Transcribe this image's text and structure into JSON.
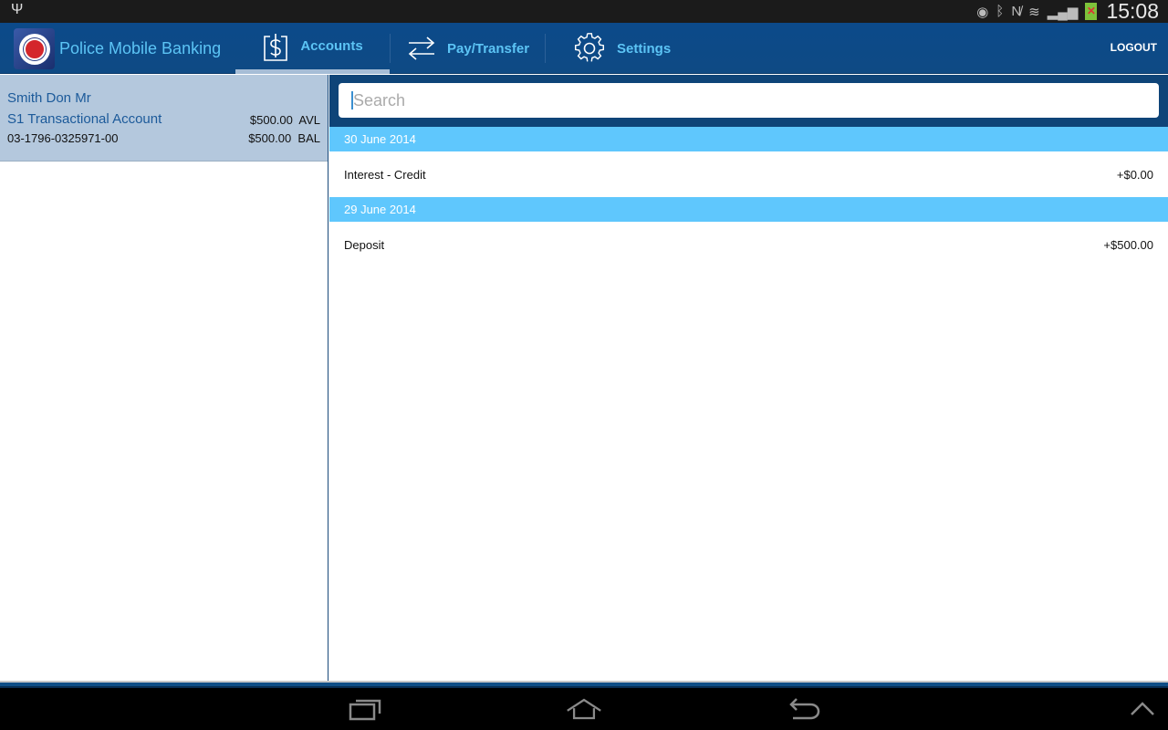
{
  "status_bar": {
    "usb_icon": "usb-icon",
    "icons": [
      "eye-icon",
      "bluetooth-icon",
      "nfc-muted-icon",
      "wifi-icon",
      "signal-icon",
      "battery-icon"
    ],
    "time": "15:08"
  },
  "action_bar": {
    "app_title": "Police Mobile Banking",
    "tabs": [
      {
        "label": "Accounts",
        "icon": "dollar-icon",
        "active": true
      },
      {
        "label": "Pay/Transfer",
        "icon": "transfer-arrows-icon",
        "active": false
      },
      {
        "label": "Settings",
        "icon": "gear-icon",
        "active": false
      }
    ],
    "logout_label": "LOGOUT"
  },
  "accounts": [
    {
      "holder": "Smith Don Mr",
      "type": "S1 Transactional Account",
      "number": "03-1796-0325971-00",
      "available": "$500.00  AVL",
      "balance": "$500.00  BAL"
    }
  ],
  "search": {
    "placeholder": "Search",
    "value": ""
  },
  "transactions": [
    {
      "date": "30 June 2014",
      "items": [
        {
          "description": "Interest - Credit",
          "amount": "+$0.00"
        }
      ]
    },
    {
      "date": "29 June 2014",
      "items": [
        {
          "description": "Deposit",
          "amount": "+$500.00"
        }
      ]
    }
  ],
  "colors": {
    "action_bar": "#0c4a8a",
    "accent_text": "#5cc4f5",
    "date_header": "#5fc7fd",
    "selected_account": "#b4c8dd"
  }
}
